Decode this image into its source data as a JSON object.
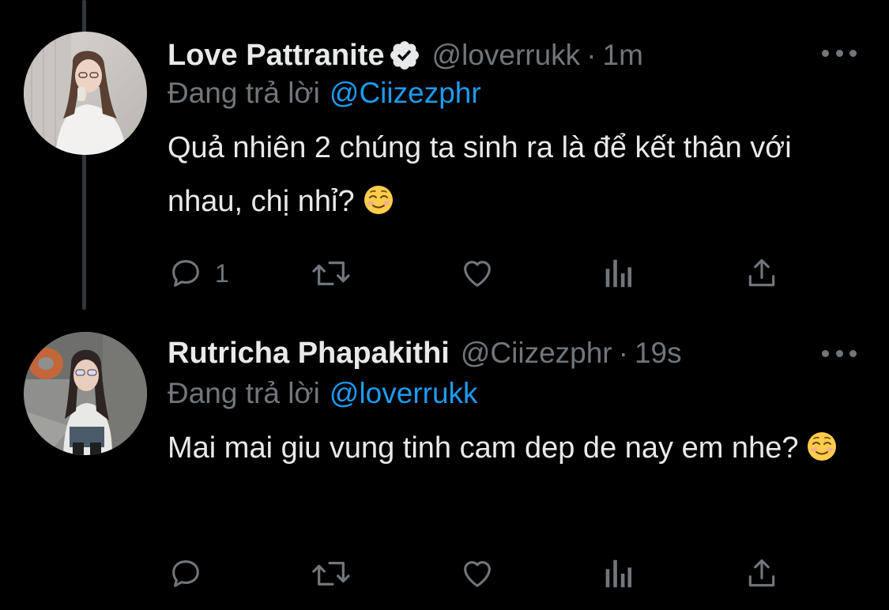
{
  "colors": {
    "background": "#000000",
    "primary_text": "#e7e9ea",
    "secondary_text": "#71767b",
    "link": "#1d9bf0",
    "thread_line": "#333639"
  },
  "tweets": [
    {
      "display_name": "Love Pattranite",
      "verified": true,
      "handle": "@loverrukk",
      "separator": "·",
      "time": "1m",
      "reply_prefix": "Đang trả lời",
      "reply_to": "@Ciizezphr",
      "text": "Quả nhiên 2 chúng ta sinh ra là để kết thân với nhau, chị nhỉ?",
      "emoji": "smiling-face-icon",
      "reply_count": "1"
    },
    {
      "display_name": "Rutricha Phapakithi",
      "verified": false,
      "handle": "@Ciizezphr",
      "separator": "·",
      "time": "19s",
      "reply_prefix": "Đang trả lời",
      "reply_to": "@loverrukk",
      "text": "Mai mai giu vung tinh cam dep de nay em nhe?",
      "emoji": "smiling-face-icon",
      "reply_count": ""
    }
  ],
  "icons": {
    "reply": "comment-icon",
    "retweet": "retweet-icon",
    "like": "heart-icon",
    "views": "analytics-icon",
    "share": "share-icon",
    "more": "more-icon",
    "verified": "verified-badge-icon"
  }
}
